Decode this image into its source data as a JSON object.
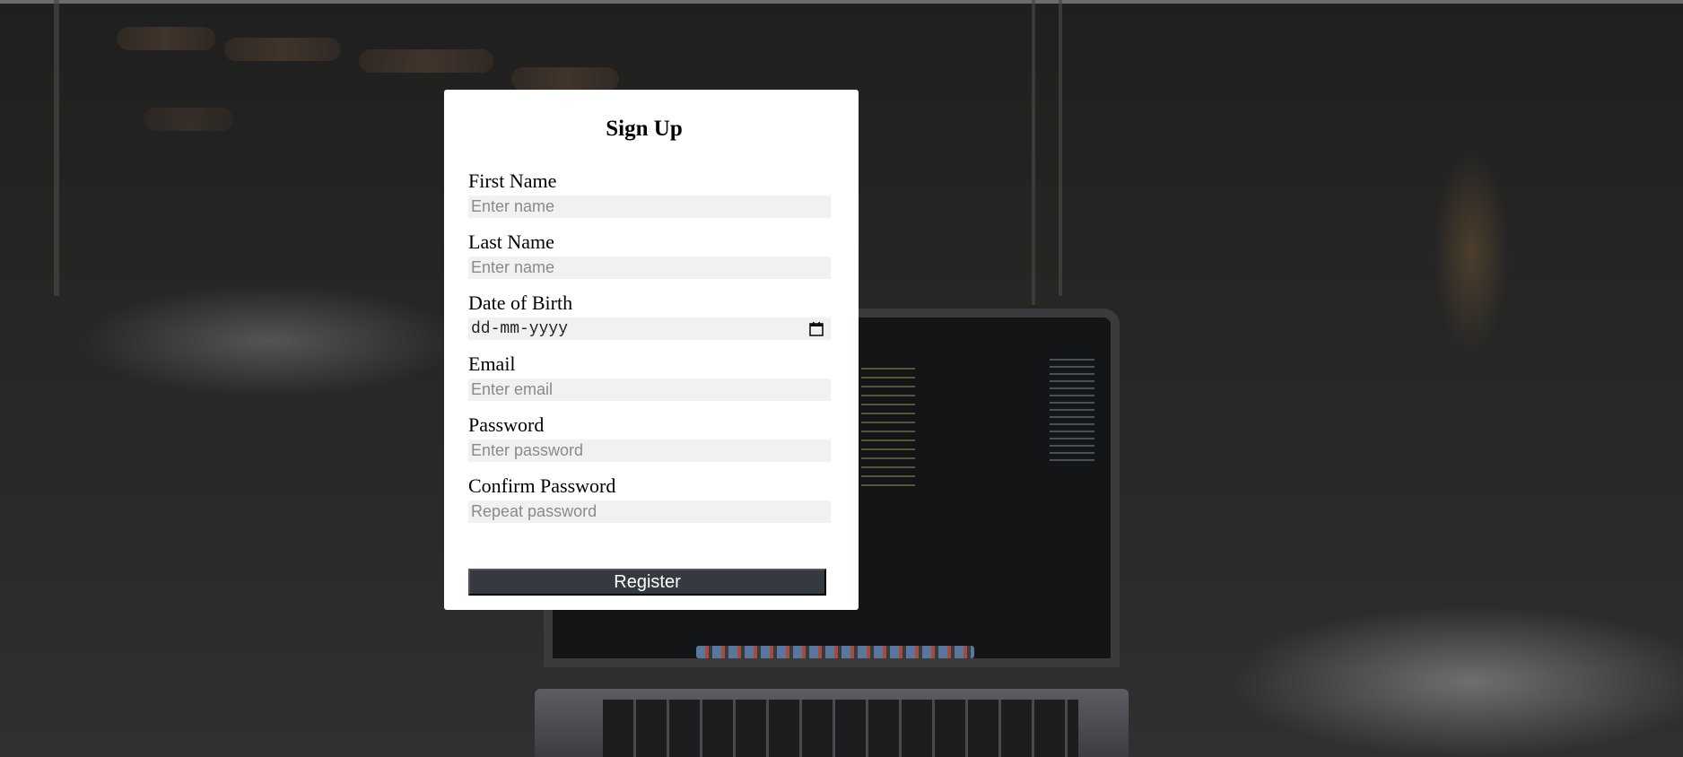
{
  "form": {
    "title": "Sign Up",
    "fields": [
      {
        "label": "First Name",
        "placeholder": "Enter name",
        "type": "text"
      },
      {
        "label": "Last Name",
        "placeholder": "Enter name",
        "type": "text"
      },
      {
        "label": "Date of Birth",
        "placeholder": "dd-mm-yyyy",
        "type": "date"
      },
      {
        "label": "Email",
        "placeholder": "Enter email",
        "type": "email"
      },
      {
        "label": "Password",
        "placeholder": "Enter password",
        "type": "password"
      },
      {
        "label": "Confirm Password",
        "placeholder": "Repeat password",
        "type": "password"
      }
    ],
    "submit_label": "Register"
  },
  "icons": {
    "date_picker": "calendar-icon"
  },
  "colors": {
    "card_background": "#ffffff",
    "input_background": "#f1f1f1",
    "button_background": "#343a40",
    "button_text": "#ffffff",
    "page_background": "#262625"
  }
}
